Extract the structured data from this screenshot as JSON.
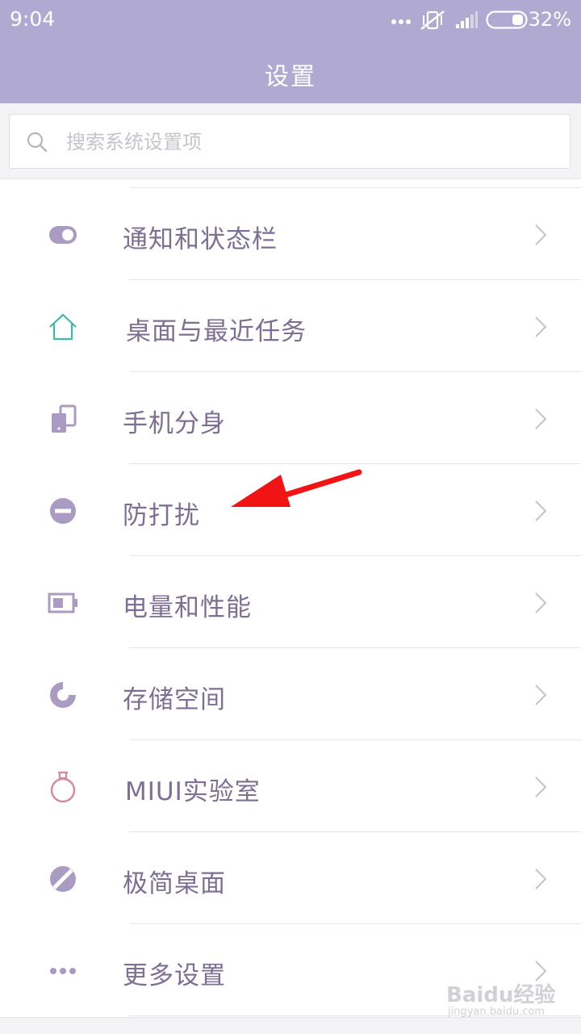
{
  "status_bar": {
    "time": "9:04",
    "battery_percent": "32%",
    "icons": [
      "more-dots-icon",
      "mute-vibrate-icon",
      "signal-icon",
      "battery-icon"
    ]
  },
  "header": {
    "title": "设置"
  },
  "search": {
    "placeholder": "搜索系统设置项",
    "value": ""
  },
  "settings": {
    "items": [
      {
        "label": "通知和状态栏",
        "icon": "toggle-icon"
      },
      {
        "label": "桌面与最近任务",
        "icon": "home-icon"
      },
      {
        "label": "手机分身",
        "icon": "phone-clone-icon"
      },
      {
        "label": "防打扰",
        "icon": "do-not-disturb-icon"
      },
      {
        "label": "电量和性能",
        "icon": "battery-performance-icon"
      },
      {
        "label": "存储空间",
        "icon": "storage-pie-icon"
      },
      {
        "label": "MIUI实验室",
        "icon": "lab-flask-icon"
      },
      {
        "label": "极简桌面",
        "icon": "minimal-desktop-icon"
      },
      {
        "label": "更多设置",
        "icon": "more-settings-icon"
      }
    ]
  },
  "annotation": {
    "type": "red-arrow",
    "points_to": "防打扰"
  },
  "watermark": {
    "brand": "Baidu经验",
    "url": "jingyan.baidu.com"
  },
  "colors": {
    "header_bg": "#b0a9d1",
    "label_text": "#7d6e93",
    "icon_purple": "#a99bc2",
    "icon_teal": "#3fb8a6",
    "icon_red": "#d48a9a",
    "arrow_red": "#f01414"
  }
}
